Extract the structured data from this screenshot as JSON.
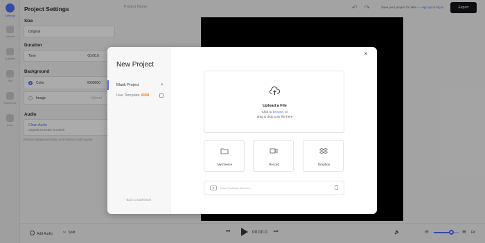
{
  "rail": [
    {
      "label": "Settings",
      "icon": "gear-icon",
      "active": true
    },
    {
      "label": "Upload",
      "icon": "upload-icon"
    },
    {
      "label": "Subtitles",
      "icon": "subtitles-icon"
    },
    {
      "label": "Text",
      "icon": "text-icon"
    },
    {
      "label": "Elements",
      "icon": "elements-icon"
    },
    {
      "label": "Draw",
      "icon": "pencil-icon"
    }
  ],
  "panel": {
    "title": "Project Settings",
    "size_label": "Size",
    "size_value": "Original",
    "duration_label": "Duration",
    "time_label": "Time",
    "time_value": "00:00.0",
    "background_label": "Background",
    "color_label": "Color",
    "color_value": "#000000",
    "image_label": "Image",
    "image_hint": "Upload",
    "audio_label": "Audio",
    "clean_audio_title": "Clean Audio",
    "clean_audio_sub": "Upgrade to BASIC to unlock",
    "audio_desc": "Remove background noise and enhance audio quality"
  },
  "topbar": {
    "project_name_placeholder": "Project Name",
    "save_prefix": "Save your project for later —",
    "sign_up": "sign up",
    "or": "or",
    "log_in": "log in",
    "export_label": "Export"
  },
  "bottombar": {
    "add_audio": "Add Audio",
    "split": "Split",
    "time": "00:00.0",
    "fit": "Fit",
    "zoom_fraction": 0.72
  },
  "modal": {
    "title": "New Project",
    "options": [
      {
        "label": "Blank Project",
        "mark": "+"
      },
      {
        "label": "Use Template",
        "badge": "NEW"
      }
    ],
    "back_link": "Back to Dashboard",
    "upload_title": "Upload a File",
    "upload_line1_pre": "Click to",
    "upload_line1_link": "browse",
    "upload_line1_post": ", or",
    "upload_line2": "drag & drop your file here",
    "sources": [
      {
        "label": "My Device",
        "icon": "folder-icon"
      },
      {
        "label": "Record",
        "icon": "camera-icon"
      },
      {
        "label": "Dropbox",
        "icon": "dropbox-icon"
      }
    ],
    "youtube_placeholder": "Insert YouTube link here..."
  },
  "colors": {
    "accent": "#4f6ef7",
    "export_bg": "#151518",
    "canvas_bg": "#000000",
    "badge": "#f2a35b"
  }
}
